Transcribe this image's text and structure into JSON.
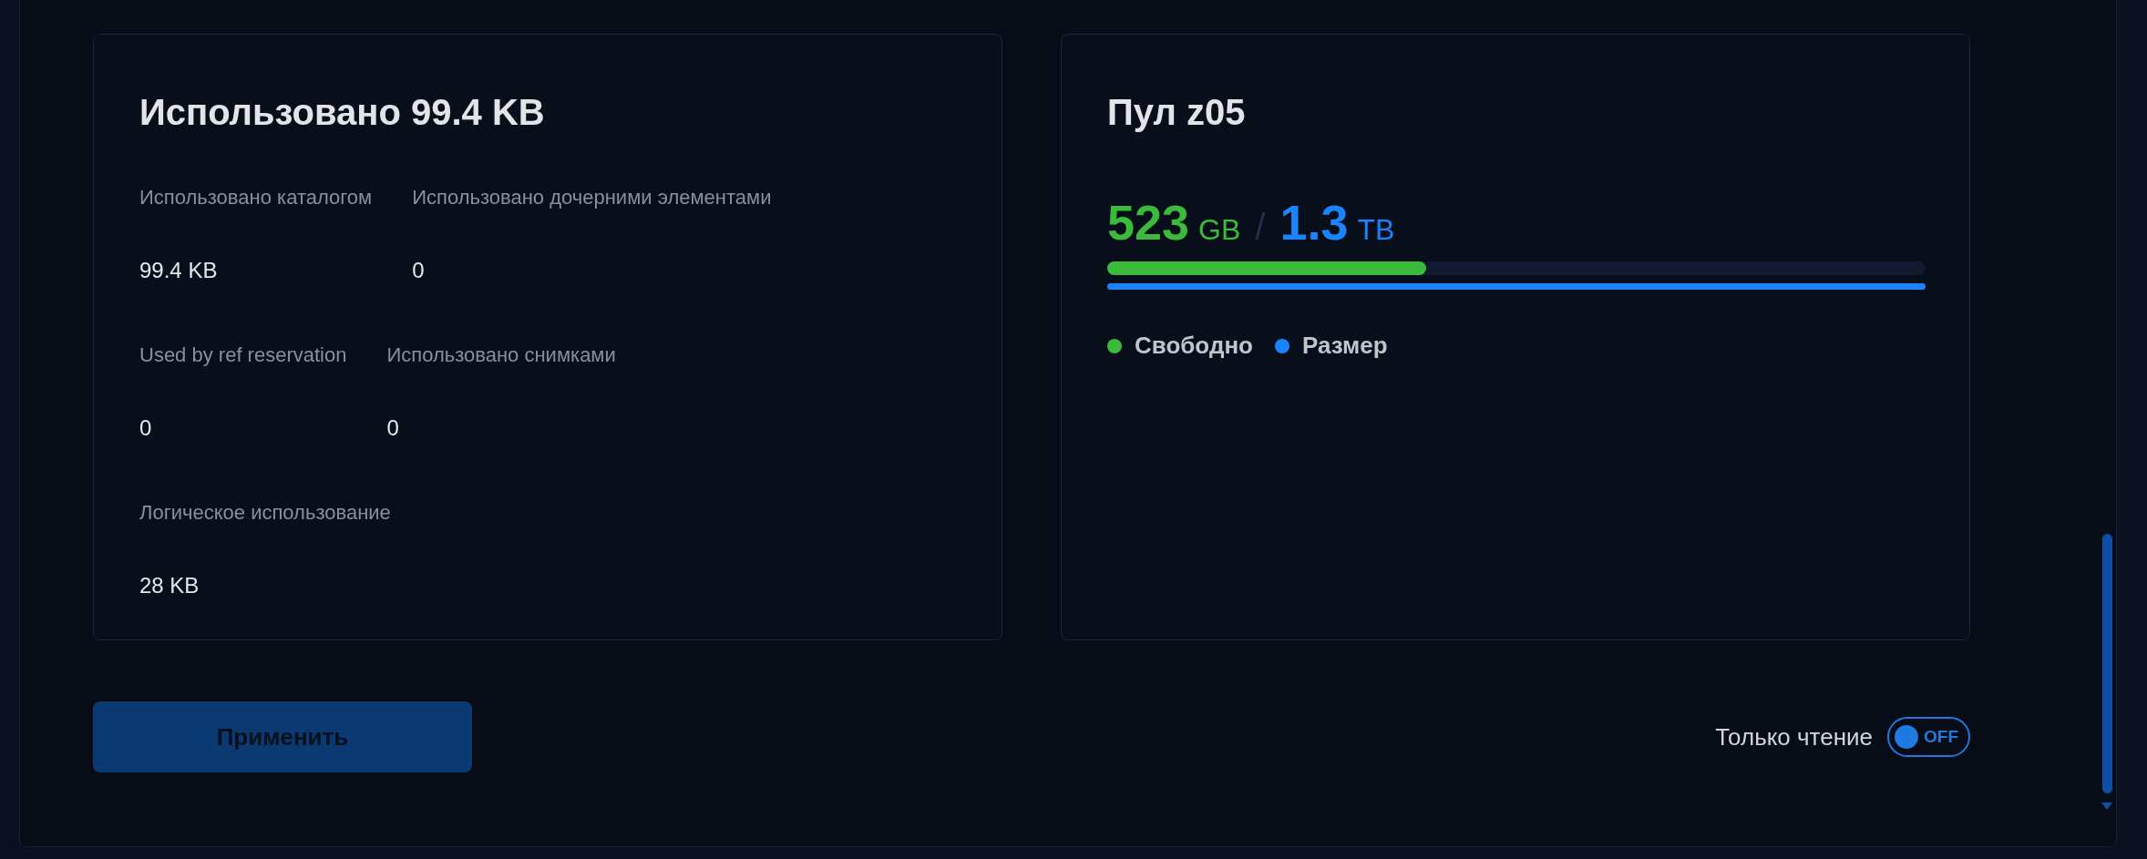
{
  "usage_card": {
    "title": "Использовано 99.4 KB",
    "rows": [
      [
        {
          "label": "Использовано каталогом",
          "value": "99.4 KB"
        },
        {
          "label": "Использовано дочерними элементами",
          "value": "0"
        }
      ],
      [
        {
          "label": "Used by ref reservation",
          "value": "0"
        },
        {
          "label": "Использовано снимками",
          "value": "0"
        }
      ],
      [
        {
          "label": "Логическое использование",
          "value": "28 KB"
        }
      ]
    ]
  },
  "pool_card": {
    "title": "Пул z05",
    "free": {
      "number": "523",
      "unit": "GB",
      "level": 0.39,
      "color": "#3cba3c"
    },
    "separator": "/",
    "size": {
      "number": "1.3",
      "unit": "TB",
      "level": 1,
      "color": "#1a84ff"
    },
    "legend": [
      {
        "label": "Свободно",
        "color": "#3cba3c"
      },
      {
        "label": "Размер",
        "color": "#1a84ff"
      }
    ]
  },
  "apply_button": {
    "label": "Применить",
    "disabled": true
  },
  "readonly_toggle": {
    "label": "Только чтение",
    "state_text": "OFF",
    "on": false
  }
}
